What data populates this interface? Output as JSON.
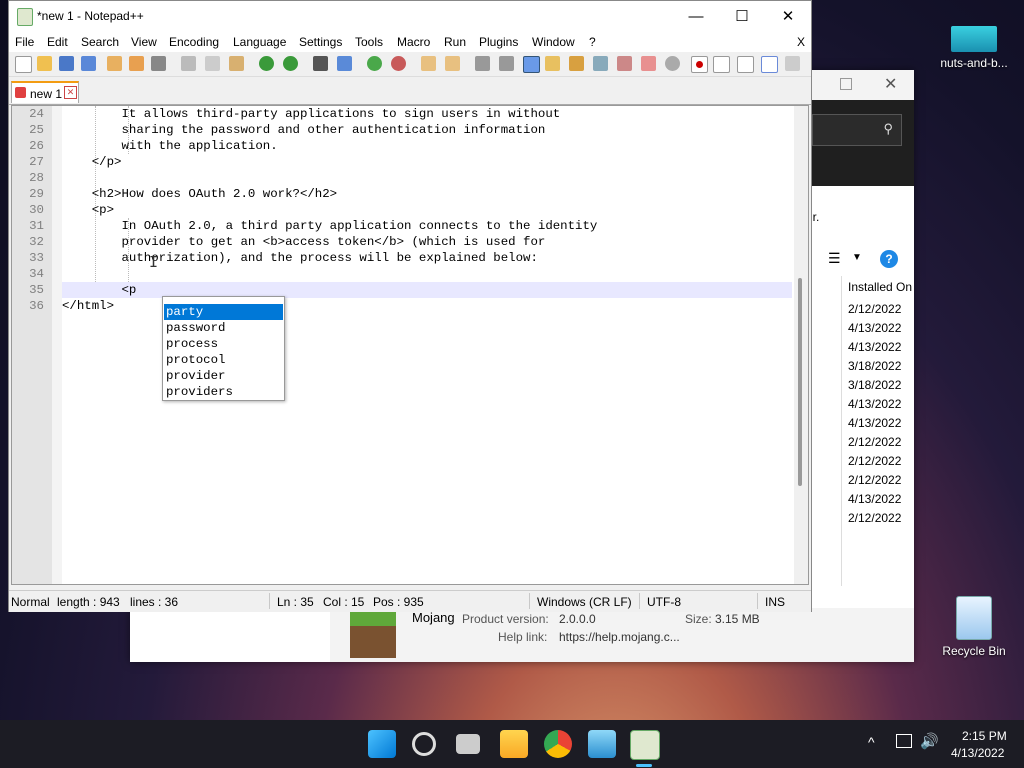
{
  "desktop": {
    "icons": [
      {
        "label": "nuts-and-b..."
      },
      {
        "label": "Recycle Bin"
      }
    ]
  },
  "background_window": {
    "partial_text": "ir.",
    "column_header": "Installed On",
    "dates": [
      "2/12/2022",
      "4/13/2022",
      "4/13/2022",
      "3/18/2022",
      "3/18/2022",
      "4/13/2022",
      "4/13/2022",
      "2/12/2022",
      "2/12/2022",
      "2/12/2022",
      "4/13/2022",
      "2/12/2022"
    ],
    "footer": {
      "publisher": "Mojang",
      "product_version_label": "Product version:",
      "product_version": "2.0.0.0",
      "size_label": "Size:",
      "size": "3.15 MB",
      "help_label": "Help link:",
      "help_link": "https://help.mojang.c..."
    }
  },
  "notepad": {
    "title": "*new 1 - Notepad++",
    "menu": [
      "File",
      "Edit",
      "Search",
      "View",
      "Encoding",
      "Language",
      "Settings",
      "Tools",
      "Macro",
      "Run",
      "Plugins",
      "Window",
      "?"
    ],
    "menu_close": "X",
    "tab_label": "new 1",
    "lines": [
      {
        "n": "24",
        "text": "        It allows third-party applications to sign users in without"
      },
      {
        "n": "25",
        "text": "        sharing the password and other authentication information"
      },
      {
        "n": "26",
        "text": "        with the application."
      },
      {
        "n": "27",
        "text": "    </p>"
      },
      {
        "n": "28",
        "text": ""
      },
      {
        "n": "29",
        "text": "    <h2>How does OAuth 2.0 work?</h2>"
      },
      {
        "n": "30",
        "text": "    <p>"
      },
      {
        "n": "31",
        "text": "        In OAuth 2.0, a third party application connects to the identity"
      },
      {
        "n": "32",
        "text": "        provider to get an <b>access token</b> (which is used for"
      },
      {
        "n": "33",
        "text": "        authorization), and the process will be explained below:"
      },
      {
        "n": "34",
        "text": ""
      },
      {
        "n": "35",
        "text": "        <p"
      },
      {
        "n": "36",
        "text": "</html>"
      }
    ],
    "autocomplete": [
      "party",
      "password",
      "process",
      "protocol",
      "provider",
      "providers"
    ],
    "status": {
      "mode": "Normal",
      "length": "length : 943",
      "lines": "lines : 36",
      "ln": "Ln : 35",
      "col": "Col : 15",
      "pos": "Pos : 935",
      "eol": "Windows (CR LF)",
      "encoding": "UTF-8",
      "ins": "INS"
    }
  },
  "taskbar": {
    "time": "2:15 PM",
    "date": "4/13/2022"
  },
  "colors": {
    "selection": "#0078d7",
    "current_line": "#e8e8ff",
    "tab_accent": "#f39c12"
  }
}
